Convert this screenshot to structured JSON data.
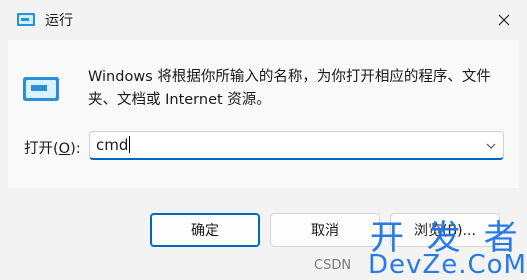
{
  "window": {
    "title": "运行",
    "close_glyph": "✕"
  },
  "dialog": {
    "description": "Windows 将根据你所输入的名称，为你打开相应的程序、文件夹、文档或 Internet 资源。",
    "open_label_prefix": "打开(",
    "open_label_accel": "O",
    "open_label_suffix": "):",
    "command_value": "cmd"
  },
  "buttons": {
    "ok": "确定",
    "cancel": "取消",
    "browse": "浏览(B)..."
  },
  "watermark": {
    "main": "开 发 者",
    "sub": "DevZe.CoM",
    "source": "CSDN"
  },
  "colors": {
    "accent": "#0067c0",
    "watermark": "#1e73e8"
  },
  "icons": [
    "run-app-icon",
    "run-large-icon",
    "close-icon",
    "chevron-down-icon"
  ]
}
